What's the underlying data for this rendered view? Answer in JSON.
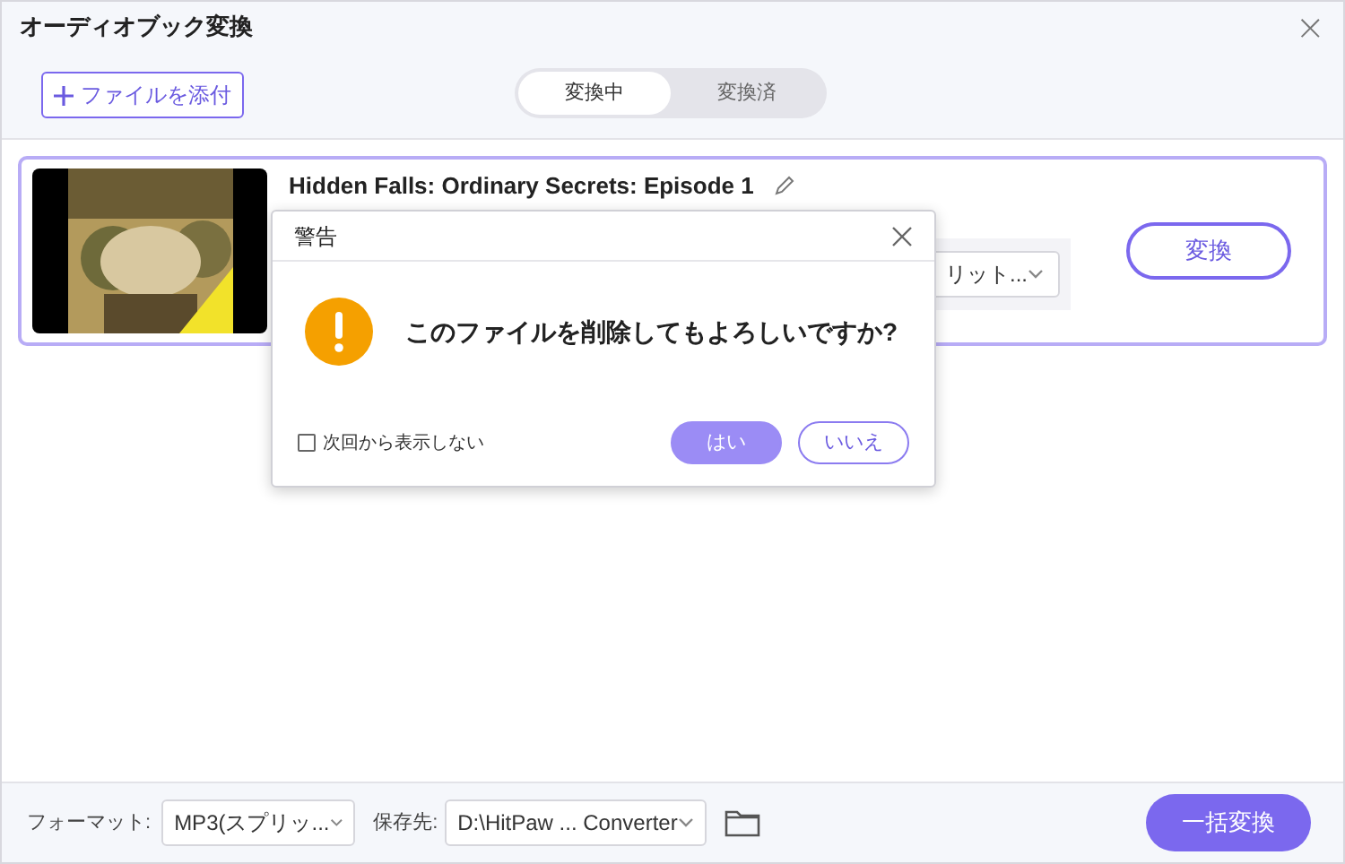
{
  "window": {
    "title": "オーディオブック変換",
    "close": "×"
  },
  "toolbar": {
    "add_button": "ファイルを添付",
    "tabs": [
      {
        "label": "変換中",
        "selected": true
      },
      {
        "label": "変換済",
        "selected": false
      }
    ]
  },
  "files": [
    {
      "title": "Hidden Falls: Ordinary Secrets: Episode 1",
      "format_value": "リット...",
      "convert_button": "変換"
    }
  ],
  "dialog": {
    "title": "警告",
    "message": "このファイルを削除してもよろしいですか?",
    "checkbox": {
      "label": "次回から表示しない",
      "checked": false
    },
    "buttons": [
      {
        "label": "はい",
        "kind": "primary"
      },
      {
        "label": "いいえ",
        "kind": "secondary"
      }
    ]
  },
  "bottom_bar": {
    "format_label": "フォーマット:",
    "format_value": "MP3(スプリッ...",
    "save_label": "保存先:",
    "save_value": "D:\\HitPaw ... Converter",
    "convert_all_button": "一括変換"
  }
}
